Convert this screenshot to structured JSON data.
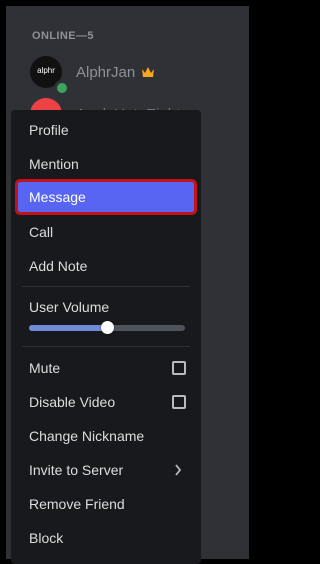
{
  "member_list": {
    "section_header": "ONLINE—5",
    "members": [
      {
        "name": "AlphrJan",
        "avatar_text": "alphr",
        "status": "online",
        "badge_icon": "crown-icon"
      },
      {
        "name": "AppleHateEight",
        "avatar_color": "#ed4245"
      }
    ]
  },
  "context_menu": {
    "items": {
      "profile": "Profile",
      "mention": "Mention",
      "message": "Message",
      "call": "Call",
      "add_note": "Add Note",
      "user_volume": "User Volume",
      "mute": "Mute",
      "disable_video": "Disable Video",
      "change_nickname": "Change Nickname",
      "invite_to_server": "Invite to Server",
      "remove_friend": "Remove Friend",
      "block": "Block"
    },
    "highlighted_item": "message",
    "user_volume_level": 0.5,
    "mute_checked": false,
    "disable_video_checked": false
  },
  "colors": {
    "background": "#2f3136",
    "menu_background": "#18191c",
    "highlight": "#5865f2",
    "highlight_outline": "#c4121a",
    "online": "#3ba55d",
    "slider_fill": "#7289da"
  }
}
